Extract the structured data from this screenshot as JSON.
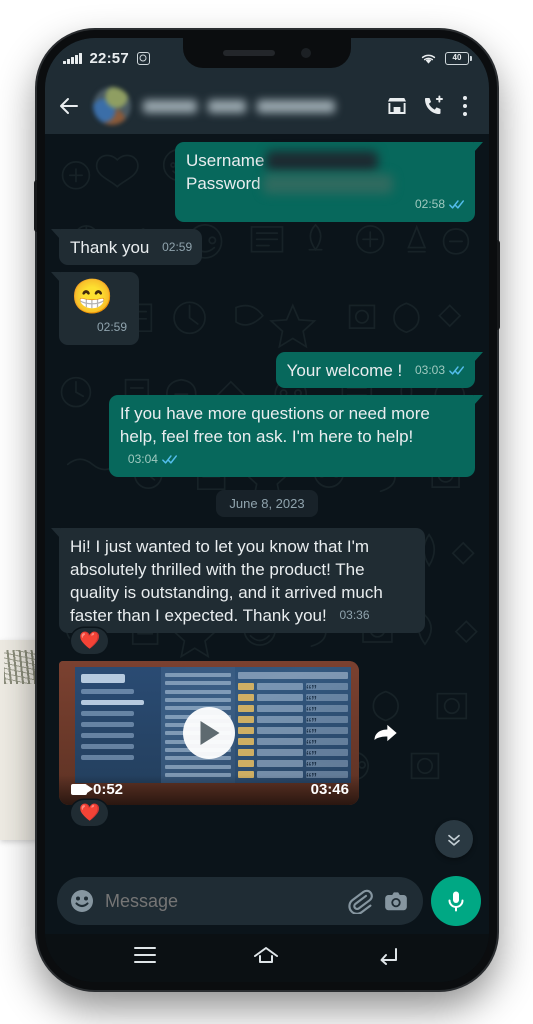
{
  "status_bar": {
    "time": "22:57",
    "battery_level": "40",
    "signal_icon": "signal-bars-icon",
    "screenshot_icon": "screenshot-icon",
    "wifi_icon": "wifi-icon",
    "battery_icon": "battery-icon"
  },
  "chat_header": {
    "back_icon": "back-arrow-icon",
    "avatar": "contact-avatar",
    "contact_name": "",
    "contact_name_redacted": true,
    "catalog_icon": "storefront-icon",
    "call_icon": "phone-add-icon",
    "menu_icon": "overflow-menu-icon"
  },
  "conversation": {
    "messages": [
      {
        "id": "credentials",
        "direction": "out",
        "type": "credentials",
        "labels": [
          "Username",
          "Password"
        ],
        "value_redacted": true,
        "time": "02:58",
        "status": "read"
      },
      {
        "id": "thank-you",
        "direction": "in",
        "type": "text",
        "text": "Thank you",
        "time": "02:59"
      },
      {
        "id": "grin-emoji",
        "direction": "in",
        "type": "emoji",
        "emoji": "😁",
        "time": "02:59"
      },
      {
        "id": "your-welcome",
        "direction": "out",
        "type": "text",
        "text": "Your welcome !",
        "time": "03:03",
        "status": "read"
      },
      {
        "id": "more-help",
        "direction": "out",
        "type": "text",
        "text": "If you have more questions or need more help, feel free ton ask. I'm here to help!",
        "time": "03:04",
        "status": "read"
      },
      {
        "id": "date-divider",
        "type": "date",
        "label": "June 8, 2023"
      },
      {
        "id": "thrilled",
        "direction": "in",
        "type": "text",
        "text": "Hi! I just wanted to let you know that I'm absolutely thrilled with the product! The quality is outstanding, and it arrived much faster than I expected. Thank you!",
        "time": "03:36",
        "reaction": "❤️"
      },
      {
        "id": "video",
        "direction": "in",
        "type": "video",
        "duration": "0:52",
        "time": "03:46",
        "reaction": "❤️",
        "play_icon": "play-icon",
        "video_camera_icon": "video-camera-icon",
        "forward_icon": "forward-icon"
      }
    ],
    "scroll_to_bottom_icon": "double-chevron-down-icon"
  },
  "input_bar": {
    "placeholder": "Message",
    "emoji_icon": "emoji-smiley-icon",
    "attach_icon": "paperclip-icon",
    "camera_icon": "camera-icon",
    "mic_icon": "microphone-icon"
  },
  "nav_bar": {
    "recents_icon": "recents-icon",
    "home_icon": "home-icon",
    "back_icon": "back-icon"
  },
  "colors": {
    "outgoing_bubble": "#07685c",
    "incoming_bubble": "#202c33",
    "chat_background": "#0b141a",
    "header": "#1f2c34",
    "accent_green": "#00a884",
    "tick_blue": "#53bdeb",
    "meta_text": "#8fa3ad"
  }
}
